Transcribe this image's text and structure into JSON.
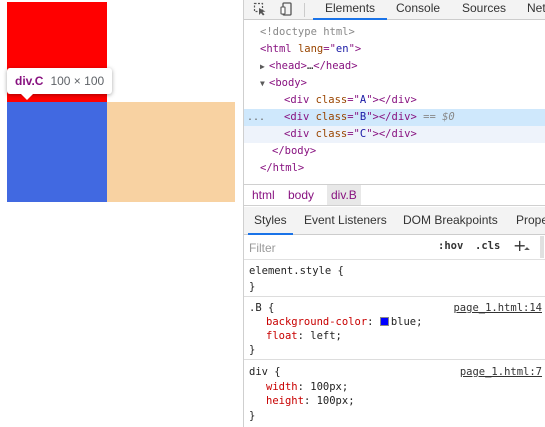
{
  "preview": {
    "tooltip": {
      "tag": "div.C",
      "size": "100 × 100"
    },
    "colors": {
      "box_a": "#ff0000",
      "box_b": "#4169e1",
      "box_c": "#f8d2a2"
    }
  },
  "devtools": {
    "toolbar_icons": [
      "inspect-icon",
      "device-toggle-icon"
    ],
    "tabs": [
      "Elements",
      "Console",
      "Sources",
      "Net"
    ],
    "active_tab": "Elements",
    "dom": {
      "doctype": "<!doctype html>",
      "html_open": {
        "tag": "html",
        "attr": "lang",
        "value": "en"
      },
      "head": {
        "open": "<head>",
        "ellipsis": "…",
        "close": "</head>"
      },
      "body_open": "<body>",
      "divs": [
        {
          "attr": "class",
          "value": "A"
        },
        {
          "attr": "class",
          "value": "B",
          "marker": "== $0"
        },
        {
          "attr": "class",
          "value": "C"
        }
      ],
      "div_close": "</div>",
      "body_close": "</body>",
      "html_close": "</html>",
      "gutter_dots": "..."
    },
    "breadcrumbs": [
      "html",
      "body",
      "div.B"
    ],
    "subtabs": [
      "Styles",
      "Event Listeners",
      "DOM Breakpoints",
      "Prope"
    ],
    "filter": {
      "placeholder": "Filter",
      "hov": ":hov",
      "cls": ".cls",
      "add": "+"
    },
    "rules": [
      {
        "selector": "element.style {",
        "source": "",
        "props": [],
        "close": "}"
      },
      {
        "selector": ".B {",
        "source": "page_1.html:14",
        "props": [
          {
            "name": "background-color",
            "value": "blue;",
            "swatch": "#0000ff"
          },
          {
            "name": "float",
            "value": "left;"
          }
        ],
        "close": "}"
      },
      {
        "selector": "div {",
        "source": "page_1.html:7",
        "props": [
          {
            "name": "width",
            "value": "100px;"
          },
          {
            "name": "height",
            "value": "100px;"
          }
        ],
        "close": "}"
      }
    ]
  }
}
